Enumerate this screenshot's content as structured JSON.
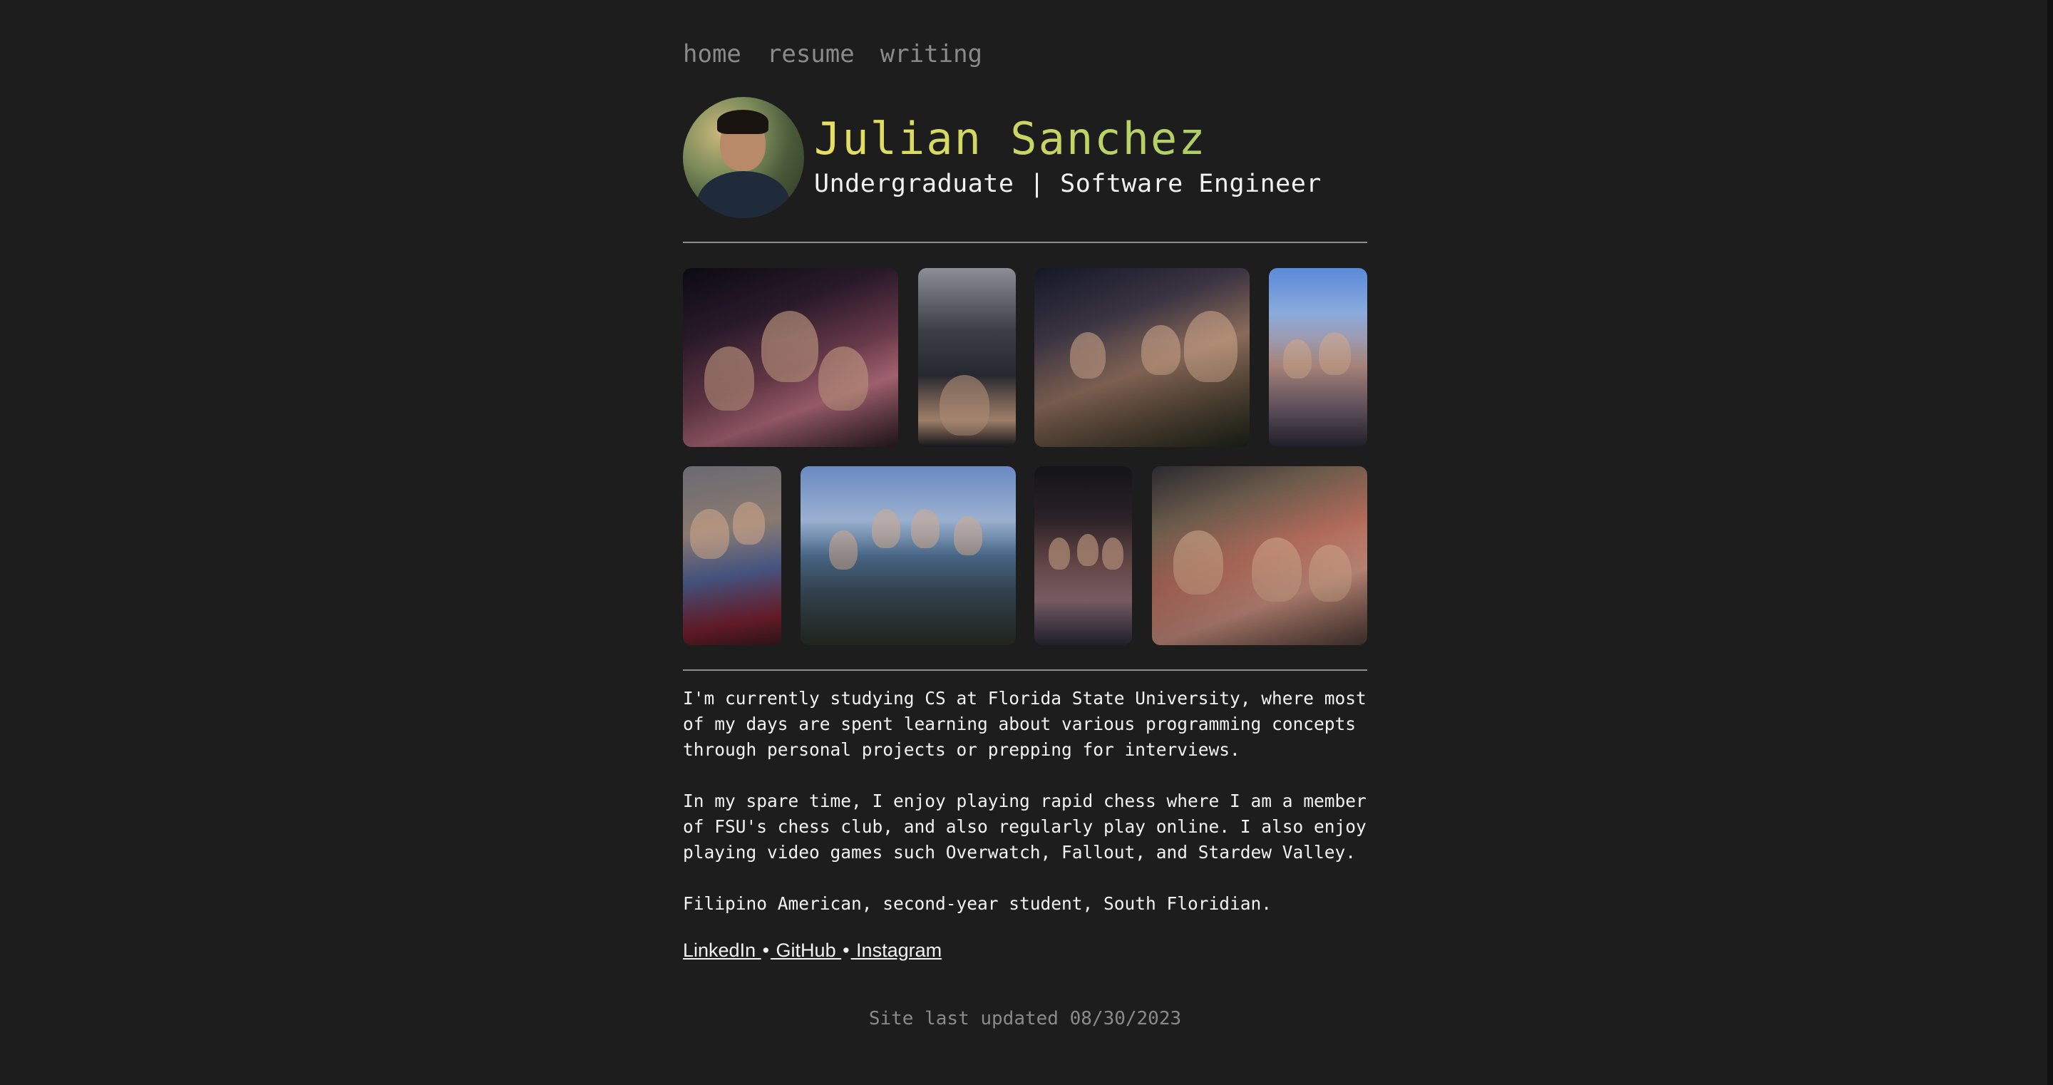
{
  "nav": {
    "items": [
      {
        "label": "home"
      },
      {
        "label": "resume"
      },
      {
        "label": "writing"
      }
    ]
  },
  "header": {
    "name": "Julian Sanchez",
    "subtitle": "Undergraduate | Software Engineer",
    "name_gradient": [
      "#e8e060",
      "#9cc86a"
    ]
  },
  "gallery": {
    "rows": [
      {
        "photos": [
          "carnival-night-photo",
          "event-selfie-photo",
          "crowd-selfie-photo",
          "group-outdoor-photo"
        ]
      },
      {
        "photos": [
          "friends-selfie-photo",
          "lake-group-photo",
          "night-group-photo",
          "restaurant-selfie-photo"
        ]
      }
    ]
  },
  "bio": {
    "paragraphs": [
      "I'm currently studying CS at Florida State University, where most of my days are spent learning about various programming concepts through personal projects or prepping for interviews.",
      "In my spare time, I enjoy playing rapid chess where I am a member of FSU's chess club, and also regularly play online. I also enjoy playing video games such Overwatch, Fallout, and Stardew Valley.",
      "Filipino American, second-year student, South Floridian."
    ]
  },
  "links": {
    "items": [
      {
        "label": "LinkedIn "
      },
      {
        "label": " GitHub "
      },
      {
        "label": " Instagram"
      }
    ],
    "separator": "•"
  },
  "footer": {
    "text": "Site last updated 08/30/2023"
  },
  "colors": {
    "background": "#1d1d1d",
    "text": "#f2f2f2",
    "muted": "#8a8a8a",
    "rule": "#8e8e8e"
  }
}
